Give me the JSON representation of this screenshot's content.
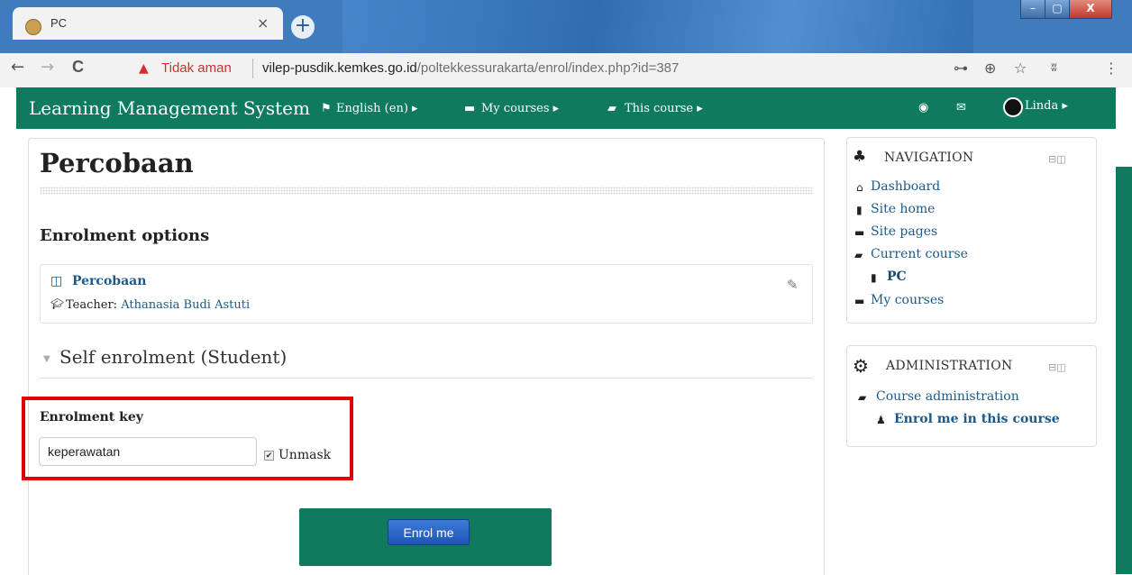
{
  "browser": {
    "tab_title": "PC",
    "tab_close": "×",
    "new_tab": "+",
    "window_controls": {
      "minimize": "–",
      "maximize": "▢",
      "close": "X"
    },
    "back": "←",
    "forward": "→",
    "reload": "C",
    "security_warning": "Tidak aman",
    "url_host": "vilep-pusdik.kemkes.go.id",
    "url_path": "/poltekkessurakarta/enrol/index.php?id=387",
    "toolbar_icons": [
      "key-icon",
      "zoom-icon",
      "star-icon",
      "extension-icon",
      "menu-icon"
    ]
  },
  "navbar": {
    "brand": "Learning Management System",
    "language": "English (en)",
    "my_courses": "My courses",
    "this_course": "This course",
    "user_name": "Linda",
    "color": "#0f7a5e"
  },
  "main": {
    "page_title": "Percobaan",
    "enrolment_heading": "Enrolment options",
    "course_name": "Percobaan",
    "teacher_label": "Teacher: ",
    "teacher_name": "Athanasia Budi Astuti",
    "self_enrolment_heading": "Self enrolment (Student)",
    "key_label": "Enrolment key",
    "key_value": "keperawatan",
    "unmask_label": "Unmask",
    "unmask_checked": true,
    "enrol_button": "Enrol me"
  },
  "navigation_block": {
    "title": "NAVIGATION",
    "items": [
      {
        "label": "Dashboard",
        "icon": "home-icon"
      },
      {
        "label": "Site home",
        "icon": "file-icon"
      },
      {
        "label": "Site pages",
        "icon": "folder-icon"
      },
      {
        "label": "Current course",
        "icon": "folder-open-icon"
      },
      {
        "label": "PC",
        "icon": "file-icon"
      },
      {
        "label": "My courses",
        "icon": "folder-icon"
      }
    ]
  },
  "administration_block": {
    "title": "ADMINISTRATION",
    "items": [
      {
        "label": "Course administration",
        "icon": "folder-open-icon"
      },
      {
        "label": "Enrol me in this course",
        "icon": "user-icon"
      }
    ]
  },
  "highlight_color": "#e00000"
}
